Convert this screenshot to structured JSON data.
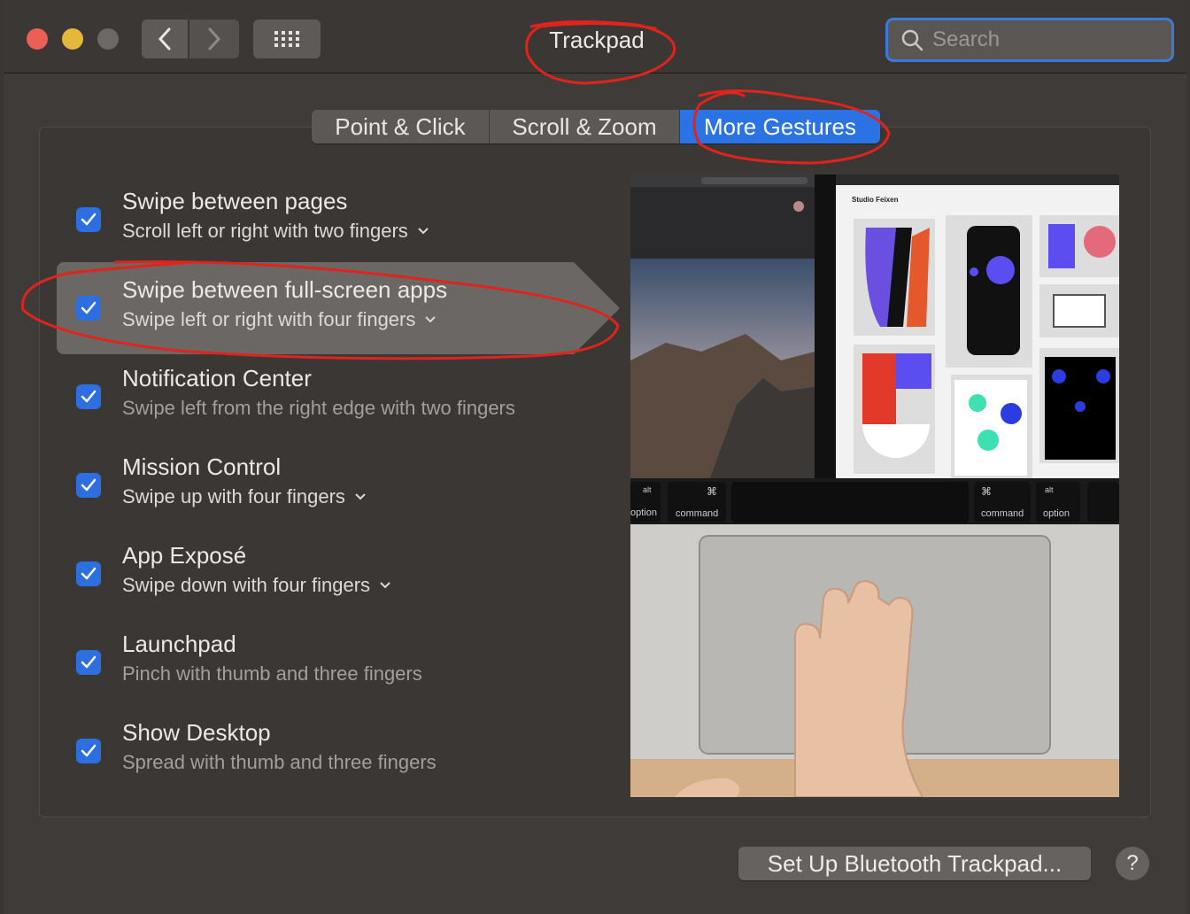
{
  "window": {
    "title": "Trackpad",
    "search_placeholder": "Search"
  },
  "tabs": [
    {
      "label": "Point & Click",
      "selected": false
    },
    {
      "label": "Scroll & Zoom",
      "selected": false
    },
    {
      "label": "More Gestures",
      "selected": true
    }
  ],
  "gestures": [
    {
      "title": "Swipe between pages",
      "subtitle": "Scroll left or right with two fingers",
      "checked": true,
      "has_menu": true
    },
    {
      "title": "Swipe between full-screen apps",
      "subtitle": "Swipe left or right with four fingers",
      "checked": true,
      "has_menu": true,
      "selected": true
    },
    {
      "title": "Notification Center",
      "subtitle": "Swipe left from the right edge with two fingers",
      "checked": true,
      "has_menu": false
    },
    {
      "title": "Mission Control",
      "subtitle": "Swipe up with four fingers",
      "checked": true,
      "has_menu": true
    },
    {
      "title": "App Exposé",
      "subtitle": "Swipe down with four fingers",
      "checked": true,
      "has_menu": true
    },
    {
      "title": "Launchpad",
      "subtitle": "Pinch with thumb and three fingers",
      "checked": true,
      "has_menu": false
    },
    {
      "title": "Show Desktop",
      "subtitle": "Spread with thumb and three fingers",
      "checked": true,
      "has_menu": false
    }
  ],
  "preview": {
    "site_name": "Studio Feixen",
    "keys": [
      "alt",
      "option",
      "⌘",
      "command",
      "⌘",
      "command",
      "alt",
      "option"
    ]
  },
  "footer": {
    "setup_label": "Set Up Bluetooth Trackpad...",
    "help_label": "?"
  },
  "colors": {
    "accent": "#2b73e4",
    "annotation": "#e0231c"
  }
}
